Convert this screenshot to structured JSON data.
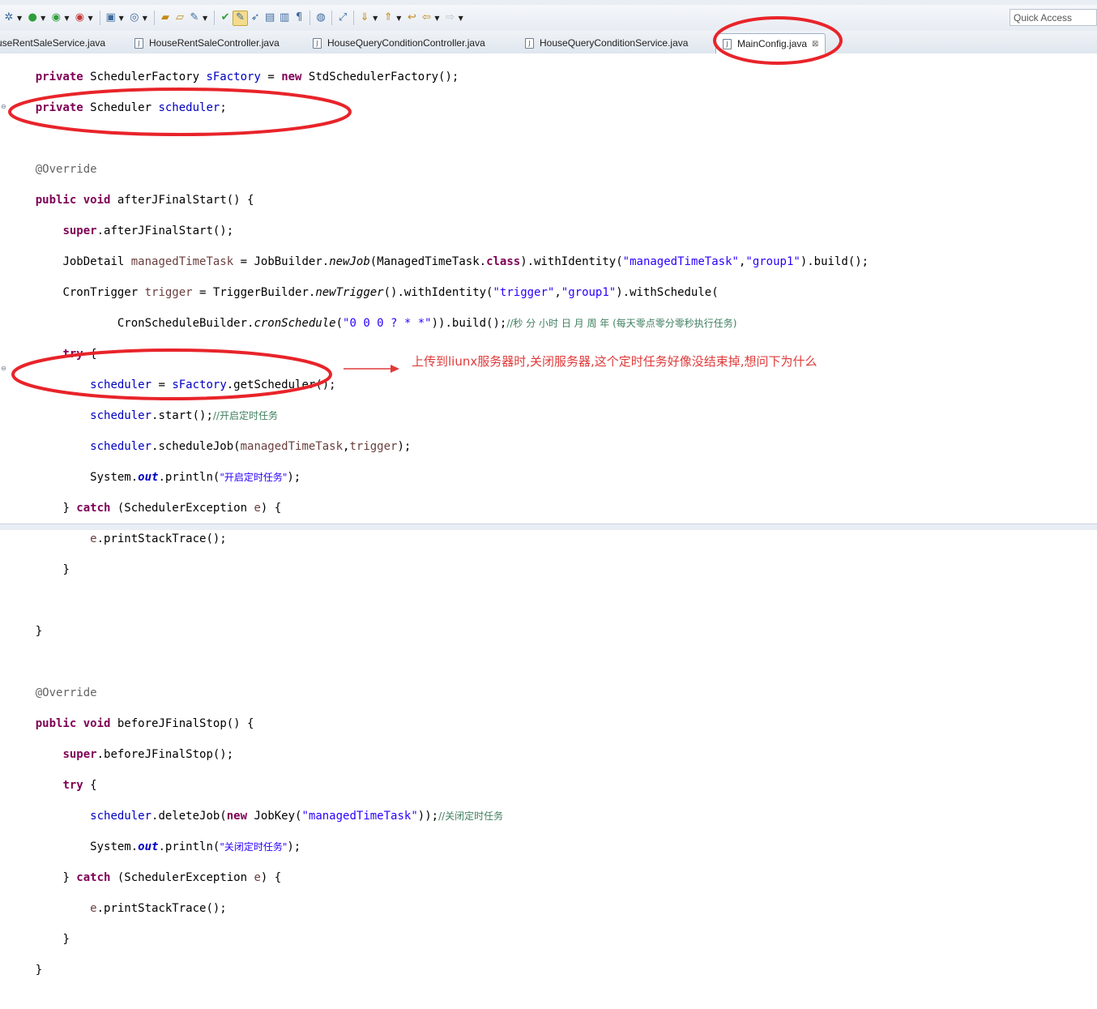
{
  "toolbar": {
    "icons": [
      "debug-icon",
      "run-icon",
      "run-as-icon",
      "external-tools-icon",
      "new-wizard-icon",
      "new-class-icon",
      "open-type-icon",
      "open-folder-icon",
      "search-icon",
      "toggle-mark-icon",
      "highlight-icon",
      "pin-icon",
      "next-annotation-icon",
      "show-whitespace-icon",
      "web-browser-icon",
      "link-icon",
      "next-edit-icon",
      "prev-edit-icon",
      "back-icon",
      "forward-icon"
    ],
    "quick_access": "Quick Access"
  },
  "tabs": [
    {
      "label": "useRentSaleService.java"
    },
    {
      "label": "HouseRentSaleController.java"
    },
    {
      "label": "HouseQueryConditionController.java"
    },
    {
      "label": "HouseQueryConditionService.java"
    },
    {
      "label": "MainConfig.java",
      "close": "⊠"
    }
  ],
  "code": {
    "l1_a": "private",
    "l1_b": " SchedulerFactory ",
    "l1_c": "sFactory",
    "l1_d": " = ",
    "l1_e": "new",
    "l1_f": " StdSchedulerFactory();",
    "l2_a": "private",
    "l2_b": " Scheduler ",
    "l2_c": "scheduler",
    "l2_d": ";",
    "l4": "@Override",
    "l5_a": "public",
    "l5_b": " ",
    "l5_c": "void",
    "l5_d": " afterJFinalStart() {",
    "l6_a": "super",
    "l6_b": ".afterJFinalStart();",
    "l7_a": "JobDetail ",
    "l7_b": "managedTimeTask",
    "l7_c": " = JobBuilder.",
    "l7_d": "newJob",
    "l7_e": "(ManagedTimeTask.",
    "l7_f": "class",
    "l7_g": ").withIdentity(",
    "l7_h": "\"managedTimeTask\"",
    "l7_i": ",",
    "l7_j": "\"group1\"",
    "l7_k": ").build();",
    "l8_a": "CronTrigger ",
    "l8_b": "trigger",
    "l8_c": " = TriggerBuilder.",
    "l8_d": "newTrigger",
    "l8_e": "().withIdentity(",
    "l8_f": "\"trigger\"",
    "l8_g": ",",
    "l8_h": "\"group1\"",
    "l8_i": ").withSchedule(",
    "l9_a": "CronScheduleBuilder.",
    "l9_b": "cronSchedule",
    "l9_c": "(",
    "l9_d": "\"0 0 0 ? * *\"",
    "l9_e": ")).build();",
    "l9_f": "//秒 分 小时 日 月 周 年 (每天零点零分零秒执行任务)",
    "l10_a": "try",
    "l10_b": " {",
    "l11_a": "scheduler",
    "l11_b": " = ",
    "l11_c": "sFactory",
    "l11_d": ".getScheduler();",
    "l12_a": "scheduler",
    "l12_b": ".start();",
    "l12_c": "//开启定时任务",
    "l13_a": "scheduler",
    "l13_b": ".scheduleJob(",
    "l13_c": "managedTimeTask",
    "l13_d": ",",
    "l13_e": "trigger",
    "l13_f": ");",
    "l14_a": "System.",
    "l14_b": "out",
    "l14_c": ".println(",
    "l14_d": "\"开启定时任务\"",
    "l14_e": ");",
    "l15_a": "} ",
    "l15_b": "catch",
    "l15_c": " (SchedulerException ",
    "l15_d": "e",
    "l15_e": ") {",
    "l16_a": "e",
    "l16_b": ".printStackTrace();",
    "l17": "}",
    "l19": "}",
    "l21": "@Override",
    "l22_a": "public",
    "l22_b": " ",
    "l22_c": "void",
    "l22_d": " beforeJFinalStop() {",
    "l23_a": "super",
    "l23_b": ".beforeJFinalStop();",
    "l24_a": "try",
    "l24_b": " {",
    "l25_a": "scheduler",
    "l25_b": ".deleteJob(",
    "l25_c": "new",
    "l25_d": " JobKey(",
    "l25_e": "\"managedTimeTask\"",
    "l25_f": "));",
    "l25_g": "//关闭定时任务",
    "l26_a": "System.",
    "l26_b": "out",
    "l26_c": ".println(",
    "l26_d": "\"关闭定时任务\"",
    "l26_e": ");",
    "l27_a": "} ",
    "l27_b": "catch",
    "l27_c": " (SchedulerException ",
    "l27_d": "e",
    "l27_e": ") {",
    "l28_a": "e",
    "l28_b": ".printStackTrace();",
    "l29": "}",
    "l30": "}"
  },
  "annotation": {
    "note": "上传到liunx服务器时,关闭服务器,这个定时任务好像没结束掉,想问下为什么",
    "color": "#e03a3a"
  },
  "colors": {
    "keyword": "#7f0055",
    "field": "#0000c0",
    "string": "#2a00ff",
    "comment": "#3f7f5f",
    "annotation_marker": "#e8242a"
  }
}
